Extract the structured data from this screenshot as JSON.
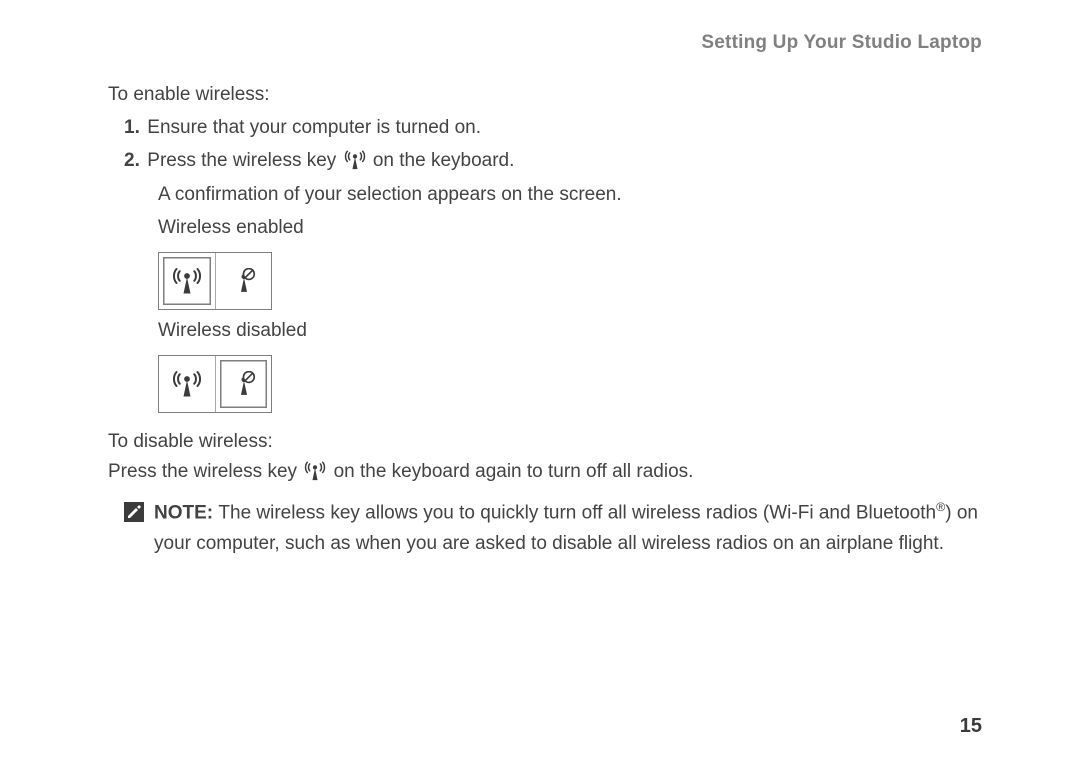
{
  "header": {
    "title": "Setting Up Your Studio Laptop"
  },
  "section": {
    "enable_intro": "To enable wireless:",
    "steps": {
      "one_num": "1.",
      "one_text": "Ensure that your computer is turned on.",
      "two_num": "2.",
      "two_pre": "Press the wireless key ",
      "two_post": " on the keyboard.",
      "confirmation": "A confirmation of your selection appears on the screen.",
      "enabled_label": "Wireless enabled",
      "disabled_label": "Wireless disabled"
    },
    "disable_intro": "To disable wireless:",
    "disable_pre": "Press the wireless key ",
    "disable_post": " on the keyboard again to turn off all radios."
  },
  "note": {
    "label": "NOTE: ",
    "text_pre": "The wireless key allows you to quickly turn off all wireless radios (Wi-Fi and Bluetooth",
    "text_post": ") on your computer, such as when you are asked to disable all wireless radios on an airplane flight.",
    "reg": "®"
  },
  "page_number": "15"
}
